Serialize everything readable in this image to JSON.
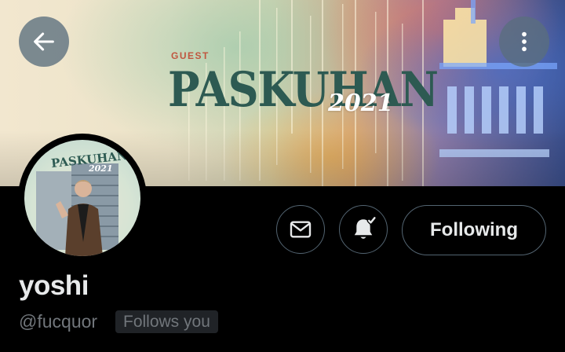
{
  "banner": {
    "guest_label": "GUEST",
    "title": "PASKUHAN",
    "year": "2021"
  },
  "header": {
    "back_icon": "arrow-left-icon",
    "more_icon": "more-vertical-icon"
  },
  "avatar": {
    "banner_text": "PASKUHAN",
    "year": "2021"
  },
  "actions": {
    "message_icon": "mail-icon",
    "notification_icon": "bell-check-icon",
    "follow_label": "Following"
  },
  "profile": {
    "display_name": "yoshi",
    "handle": "@fucquor",
    "follows_you": "Follows you"
  },
  "colors": {
    "background": "#000000",
    "text_primary": "#e7e9ea",
    "text_secondary": "#71767b",
    "border": "#536471",
    "banner_title": "#2d5a52",
    "banner_guest": "#c0563f"
  }
}
